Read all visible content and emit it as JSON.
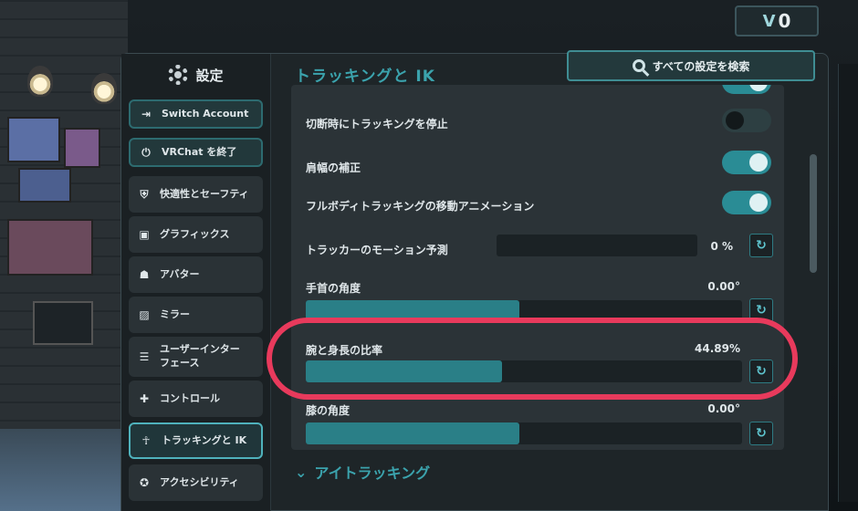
{
  "currency": {
    "symbol": "V",
    "amount": "0"
  },
  "sidebar": {
    "title": "設定",
    "items": [
      {
        "label": "Switch Account",
        "icon": "logout-icon"
      },
      {
        "label": "VRChat を終了",
        "icon": "power-icon"
      },
      {
        "label": "快適性とセーフティ",
        "icon": "shield-icon"
      },
      {
        "label": "グラフィックス",
        "icon": "image-icon"
      },
      {
        "label": "アバター",
        "icon": "avatar-icon"
      },
      {
        "label": "ミラー",
        "icon": "mirror-icon"
      },
      {
        "label": "ユーザーインターフェース",
        "label_line1": "ユーザーインター",
        "label_line2": "フェース",
        "icon": "ui-icon"
      },
      {
        "label": "コントロール",
        "icon": "gamepad-icon"
      },
      {
        "label": "トラッキングと IK",
        "icon": "tracking-icon"
      },
      {
        "label": "アクセシビリティ",
        "icon": "accessibility-icon"
      }
    ]
  },
  "content": {
    "title": "トラッキングと IK",
    "search_label": "すべての設定を検索",
    "rows": {
      "stop_tracking": {
        "label": "切断時にトラッキングを停止",
        "state": "off"
      },
      "shoulder": {
        "label": "肩幅の補正",
        "state": "on"
      },
      "fbt_anim": {
        "label": "フルボディトラッキングの移動アニメーション",
        "state": "on"
      },
      "tracker_prediction": {
        "label": "トラッカーのモーション予測",
        "value": "0 %",
        "level": 0
      },
      "wrist_angle": {
        "label": "手首の角度",
        "value": "0.00°",
        "level": 0.49
      },
      "arm_ratio": {
        "label": "腕と身長の比率",
        "value": "44.89%",
        "level": 0.4489
      },
      "knee_angle": {
        "label": "膝の角度",
        "value": "0.00°",
        "level": 0.49
      }
    },
    "next_section": "アイトラッキング"
  },
  "colors": {
    "accent": "#3ba3ad",
    "annotation": "#e83a5c"
  }
}
